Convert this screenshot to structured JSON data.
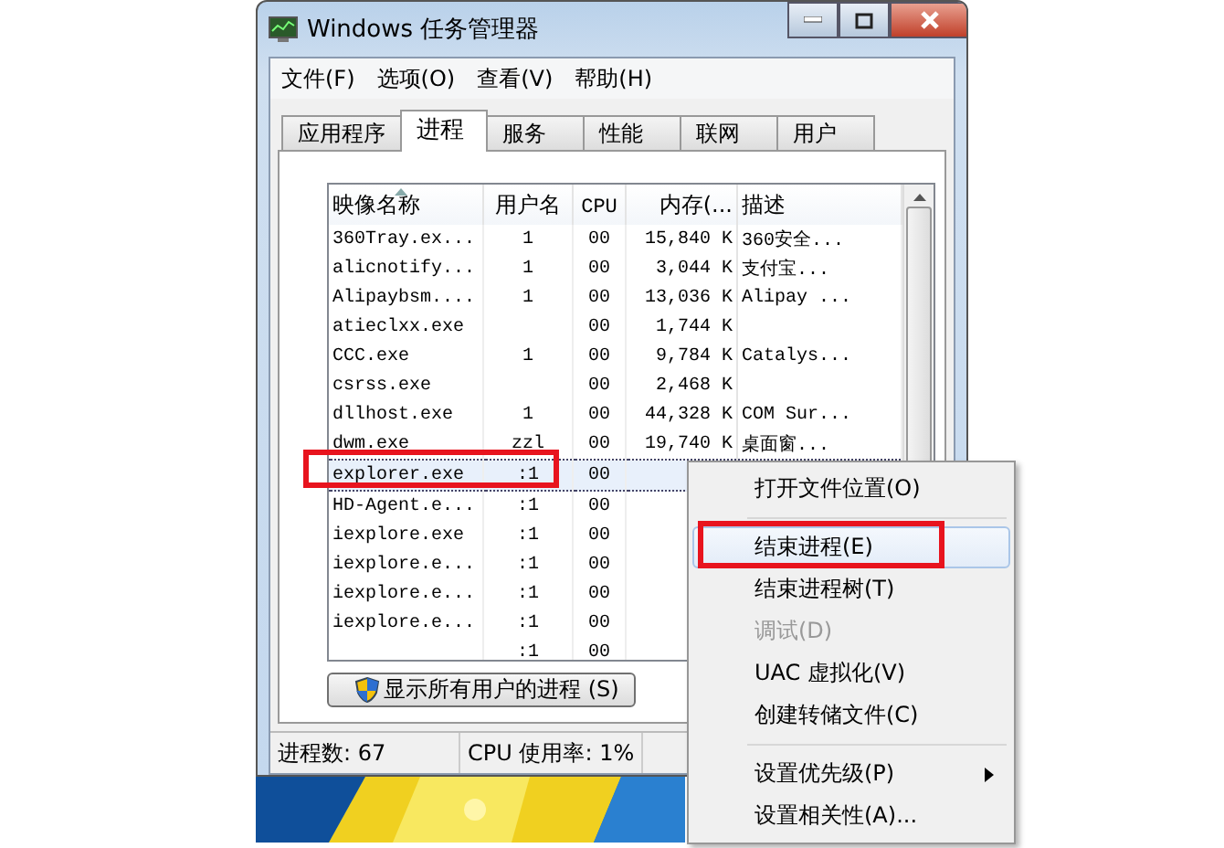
{
  "window": {
    "title": "Windows 任务管理器"
  },
  "menu_bar": [
    "文件(F)",
    "选项(O)",
    "查看(V)",
    "帮助(H)"
  ],
  "tabs": [
    {
      "label": "应用程序",
      "selected": false
    },
    {
      "label": "进程",
      "selected": true
    },
    {
      "label": "服务",
      "selected": false
    },
    {
      "label": "性能",
      "selected": false
    },
    {
      "label": "联网",
      "selected": false
    },
    {
      "label": "用户",
      "selected": false
    }
  ],
  "table": {
    "columns": [
      "映像名称",
      "用户名",
      "CPU",
      "内存(...",
      "描述"
    ],
    "rows": [
      {
        "name": "360Tray.ex...",
        "user": "1",
        "cpu": "00",
        "memory": "15,840 K",
        "description": "360安全...",
        "selected": false
      },
      {
        "name": "alicnotify...",
        "user": "1",
        "cpu": "00",
        "memory": "3,044 K",
        "description": "支付宝...",
        "selected": false
      },
      {
        "name": "Alipaybsm....",
        "user": "1",
        "cpu": "00",
        "memory": "13,036 K",
        "description": "Alipay ...",
        "selected": false
      },
      {
        "name": "atieclxx.exe",
        "cpu": "00",
        "memory": "1,744 K",
        "selected": false
      },
      {
        "name": "CCC.exe",
        "user": "1",
        "cpu": "00",
        "memory": "9,784 K",
        "description": "Catalys...",
        "selected": false
      },
      {
        "name": "csrss.exe",
        "cpu": "00",
        "memory": "2,468 K",
        "selected": false
      },
      {
        "name": "dllhost.exe",
        "user": "1",
        "cpu": "00",
        "memory": "44,328 K",
        "description": "COM Sur...",
        "selected": false
      },
      {
        "name": "dwm.exe",
        "user": "zzl",
        "cpu": "00",
        "memory": "19,740 K",
        "description": "桌面窗...",
        "selected": false
      },
      {
        "name": "explorer.exe",
        "user": ":1",
        "cpu": "00",
        "selected": true
      },
      {
        "name": "HD-Agent.e...",
        "user": ":1",
        "cpu": "00",
        "selected": false
      },
      {
        "name": "iexplore.exe",
        "user": ":1",
        "cpu": "00",
        "selected": false
      },
      {
        "name": "iexplore.e...",
        "user": ":1",
        "cpu": "00",
        "selected": false
      },
      {
        "name": "iexplore.e...",
        "user": ":1",
        "cpu": "00",
        "selected": false
      },
      {
        "name": "iexplore.e...",
        "user": ":1",
        "cpu": "00",
        "selected": false
      },
      {
        "user": ":1",
        "cpu": "00",
        "selected": false
      }
    ]
  },
  "show_all_button": "显示所有用户的进程 (S)",
  "status_bar": [
    "进程数: 67",
    "CPU 使用率: 1%"
  ],
  "context_menu": [
    {
      "kind": "item",
      "label": "打开文件位置(O)",
      "selected": false,
      "disabled": false
    },
    {
      "kind": "separator"
    },
    {
      "kind": "item",
      "label": "结束进程(E)",
      "selected": true,
      "disabled": false
    },
    {
      "kind": "item",
      "label": "结束进程树(T)",
      "selected": false,
      "disabled": false
    },
    {
      "kind": "item",
      "label": "调试(D)",
      "selected": false,
      "disabled": true
    },
    {
      "kind": "item",
      "label": "UAC 虚拟化(V)",
      "selected": false,
      "disabled": false
    },
    {
      "kind": "item",
      "label": "创建转储文件(C)",
      "selected": false,
      "disabled": false
    },
    {
      "kind": "separator"
    },
    {
      "kind": "submenu",
      "label": "设置优先级(P)",
      "selected": false,
      "disabled": false
    },
    {
      "kind": "item",
      "label": "设置相关性(A)...",
      "selected": false,
      "disabled": false
    }
  ],
  "annotations": [
    {
      "kind": "highlight"
    },
    {
      "kind": "highlight"
    }
  ]
}
